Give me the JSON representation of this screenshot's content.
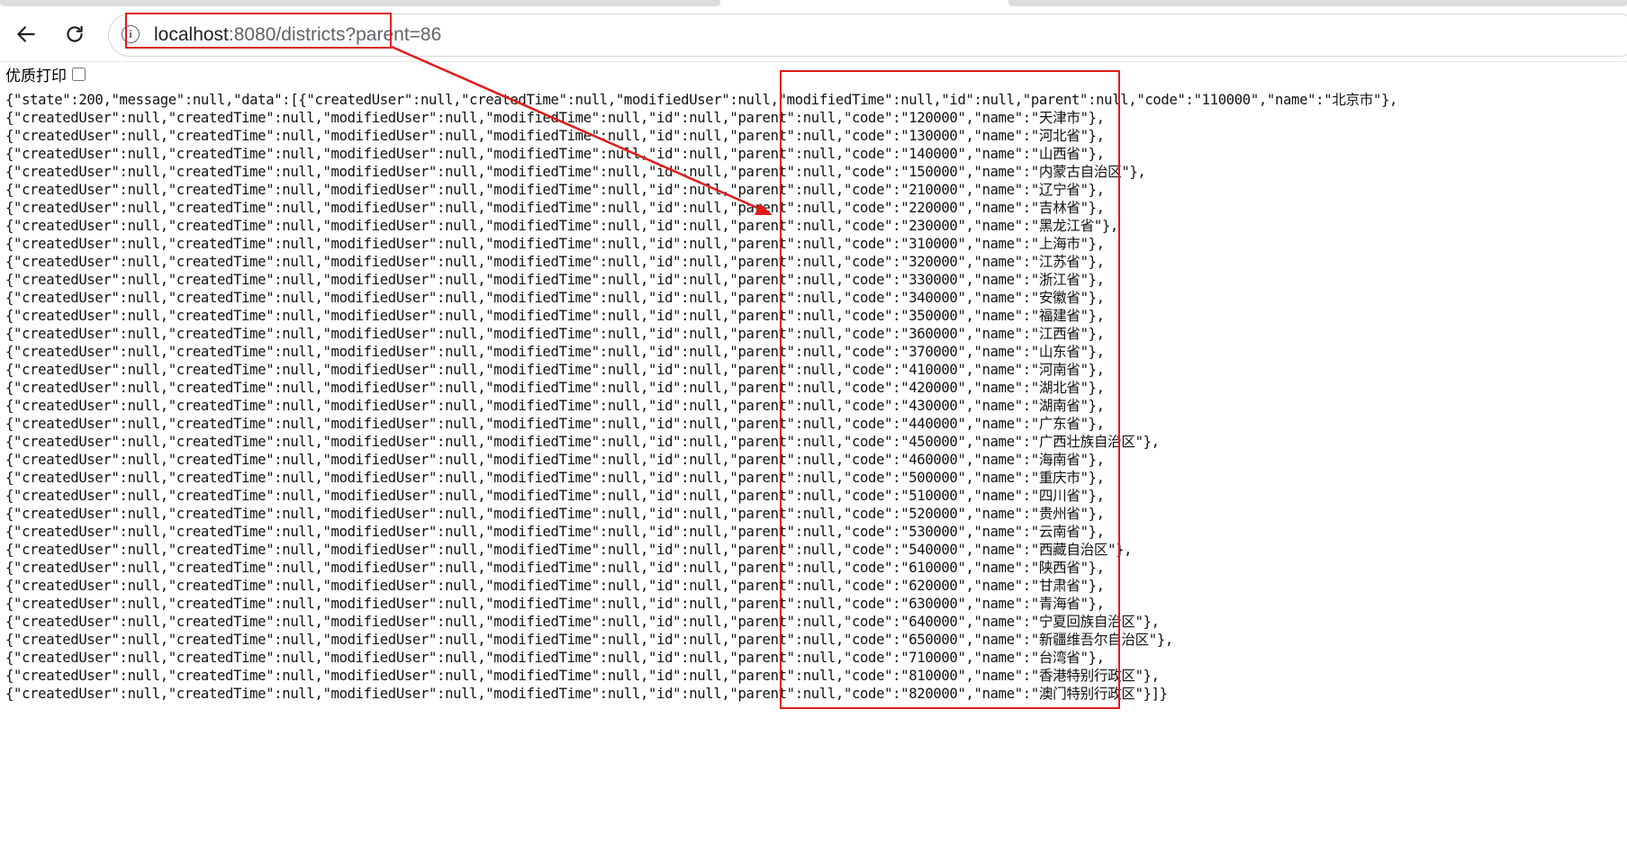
{
  "browser": {
    "address_bar": {
      "host": "localhost",
      "rest": ":8080/districts?parent=86"
    },
    "icons": {
      "back": "arrow-left-icon",
      "reload": "reload-icon",
      "site_info": "info-icon"
    },
    "site_info_glyph": "i"
  },
  "print_toggle": {
    "label": "优质打印",
    "checked": false
  },
  "response": {
    "lines": [
      "{\"state\":200,\"message\":null,\"data\":[{\"createdUser\":null,\"createdTime\":null,\"modifiedUser\":null,\"modifiedTime\":null,\"id\":null,\"parent\":null,\"code\":\"110000\",\"name\":\"北京市\"},",
      "{\"createdUser\":null,\"createdTime\":null,\"modifiedUser\":null,\"modifiedTime\":null,\"id\":null,\"parent\":null,\"code\":\"120000\",\"name\":\"天津市\"},",
      "{\"createdUser\":null,\"createdTime\":null,\"modifiedUser\":null,\"modifiedTime\":null,\"id\":null,\"parent\":null,\"code\":\"130000\",\"name\":\"河北省\"},",
      "{\"createdUser\":null,\"createdTime\":null,\"modifiedUser\":null,\"modifiedTime\":null,\"id\":null,\"parent\":null,\"code\":\"140000\",\"name\":\"山西省\"},",
      "{\"createdUser\":null,\"createdTime\":null,\"modifiedUser\":null,\"modifiedTime\":null,\"id\":null,\"parent\":null,\"code\":\"150000\",\"name\":\"内蒙古自治区\"},",
      "{\"createdUser\":null,\"createdTime\":null,\"modifiedUser\":null,\"modifiedTime\":null,\"id\":null,\"parent\":null,\"code\":\"210000\",\"name\":\"辽宁省\"},",
      "{\"createdUser\":null,\"createdTime\":null,\"modifiedUser\":null,\"modifiedTime\":null,\"id\":null,\"parent\":null,\"code\":\"220000\",\"name\":\"吉林省\"},",
      "{\"createdUser\":null,\"createdTime\":null,\"modifiedUser\":null,\"modifiedTime\":null,\"id\":null,\"parent\":null,\"code\":\"230000\",\"name\":\"黑龙江省\"},",
      "{\"createdUser\":null,\"createdTime\":null,\"modifiedUser\":null,\"modifiedTime\":null,\"id\":null,\"parent\":null,\"code\":\"310000\",\"name\":\"上海市\"},",
      "{\"createdUser\":null,\"createdTime\":null,\"modifiedUser\":null,\"modifiedTime\":null,\"id\":null,\"parent\":null,\"code\":\"320000\",\"name\":\"江苏省\"},",
      "{\"createdUser\":null,\"createdTime\":null,\"modifiedUser\":null,\"modifiedTime\":null,\"id\":null,\"parent\":null,\"code\":\"330000\",\"name\":\"浙江省\"},",
      "{\"createdUser\":null,\"createdTime\":null,\"modifiedUser\":null,\"modifiedTime\":null,\"id\":null,\"parent\":null,\"code\":\"340000\",\"name\":\"安徽省\"},",
      "{\"createdUser\":null,\"createdTime\":null,\"modifiedUser\":null,\"modifiedTime\":null,\"id\":null,\"parent\":null,\"code\":\"350000\",\"name\":\"福建省\"},",
      "{\"createdUser\":null,\"createdTime\":null,\"modifiedUser\":null,\"modifiedTime\":null,\"id\":null,\"parent\":null,\"code\":\"360000\",\"name\":\"江西省\"},",
      "{\"createdUser\":null,\"createdTime\":null,\"modifiedUser\":null,\"modifiedTime\":null,\"id\":null,\"parent\":null,\"code\":\"370000\",\"name\":\"山东省\"},",
      "{\"createdUser\":null,\"createdTime\":null,\"modifiedUser\":null,\"modifiedTime\":null,\"id\":null,\"parent\":null,\"code\":\"410000\",\"name\":\"河南省\"},",
      "{\"createdUser\":null,\"createdTime\":null,\"modifiedUser\":null,\"modifiedTime\":null,\"id\":null,\"parent\":null,\"code\":\"420000\",\"name\":\"湖北省\"},",
      "{\"createdUser\":null,\"createdTime\":null,\"modifiedUser\":null,\"modifiedTime\":null,\"id\":null,\"parent\":null,\"code\":\"430000\",\"name\":\"湖南省\"},",
      "{\"createdUser\":null,\"createdTime\":null,\"modifiedUser\":null,\"modifiedTime\":null,\"id\":null,\"parent\":null,\"code\":\"440000\",\"name\":\"广东省\"},",
      "{\"createdUser\":null,\"createdTime\":null,\"modifiedUser\":null,\"modifiedTime\":null,\"id\":null,\"parent\":null,\"code\":\"450000\",\"name\":\"广西壮族自治区\"},",
      "{\"createdUser\":null,\"createdTime\":null,\"modifiedUser\":null,\"modifiedTime\":null,\"id\":null,\"parent\":null,\"code\":\"460000\",\"name\":\"海南省\"},",
      "{\"createdUser\":null,\"createdTime\":null,\"modifiedUser\":null,\"modifiedTime\":null,\"id\":null,\"parent\":null,\"code\":\"500000\",\"name\":\"重庆市\"},",
      "{\"createdUser\":null,\"createdTime\":null,\"modifiedUser\":null,\"modifiedTime\":null,\"id\":null,\"parent\":null,\"code\":\"510000\",\"name\":\"四川省\"},",
      "{\"createdUser\":null,\"createdTime\":null,\"modifiedUser\":null,\"modifiedTime\":null,\"id\":null,\"parent\":null,\"code\":\"520000\",\"name\":\"贵州省\"},",
      "{\"createdUser\":null,\"createdTime\":null,\"modifiedUser\":null,\"modifiedTime\":null,\"id\":null,\"parent\":null,\"code\":\"530000\",\"name\":\"云南省\"},",
      "{\"createdUser\":null,\"createdTime\":null,\"modifiedUser\":null,\"modifiedTime\":null,\"id\":null,\"parent\":null,\"code\":\"540000\",\"name\":\"西藏自治区\"},",
      "{\"createdUser\":null,\"createdTime\":null,\"modifiedUser\":null,\"modifiedTime\":null,\"id\":null,\"parent\":null,\"code\":\"610000\",\"name\":\"陕西省\"},",
      "{\"createdUser\":null,\"createdTime\":null,\"modifiedUser\":null,\"modifiedTime\":null,\"id\":null,\"parent\":null,\"code\":\"620000\",\"name\":\"甘肃省\"},",
      "{\"createdUser\":null,\"createdTime\":null,\"modifiedUser\":null,\"modifiedTime\":null,\"id\":null,\"parent\":null,\"code\":\"630000\",\"name\":\"青海省\"},",
      "{\"createdUser\":null,\"createdTime\":null,\"modifiedUser\":null,\"modifiedTime\":null,\"id\":null,\"parent\":null,\"code\":\"640000\",\"name\":\"宁夏回族自治区\"},",
      "{\"createdUser\":null,\"createdTime\":null,\"modifiedUser\":null,\"modifiedTime\":null,\"id\":null,\"parent\":null,\"code\":\"650000\",\"name\":\"新疆维吾尔自治区\"},",
      "{\"createdUser\":null,\"createdTime\":null,\"modifiedUser\":null,\"modifiedTime\":null,\"id\":null,\"parent\":null,\"code\":\"710000\",\"name\":\"台湾省\"},",
      "{\"createdUser\":null,\"createdTime\":null,\"modifiedUser\":null,\"modifiedTime\":null,\"id\":null,\"parent\":null,\"code\":\"810000\",\"name\":\"香港特别行政区\"},",
      "{\"createdUser\":null,\"createdTime\":null,\"modifiedUser\":null,\"modifiedTime\":null,\"id\":null,\"parent\":null,\"code\":\"820000\",\"name\":\"澳门特别行政区\"}]}"
    ]
  },
  "annotations": {
    "color": "#e01b1b"
  }
}
